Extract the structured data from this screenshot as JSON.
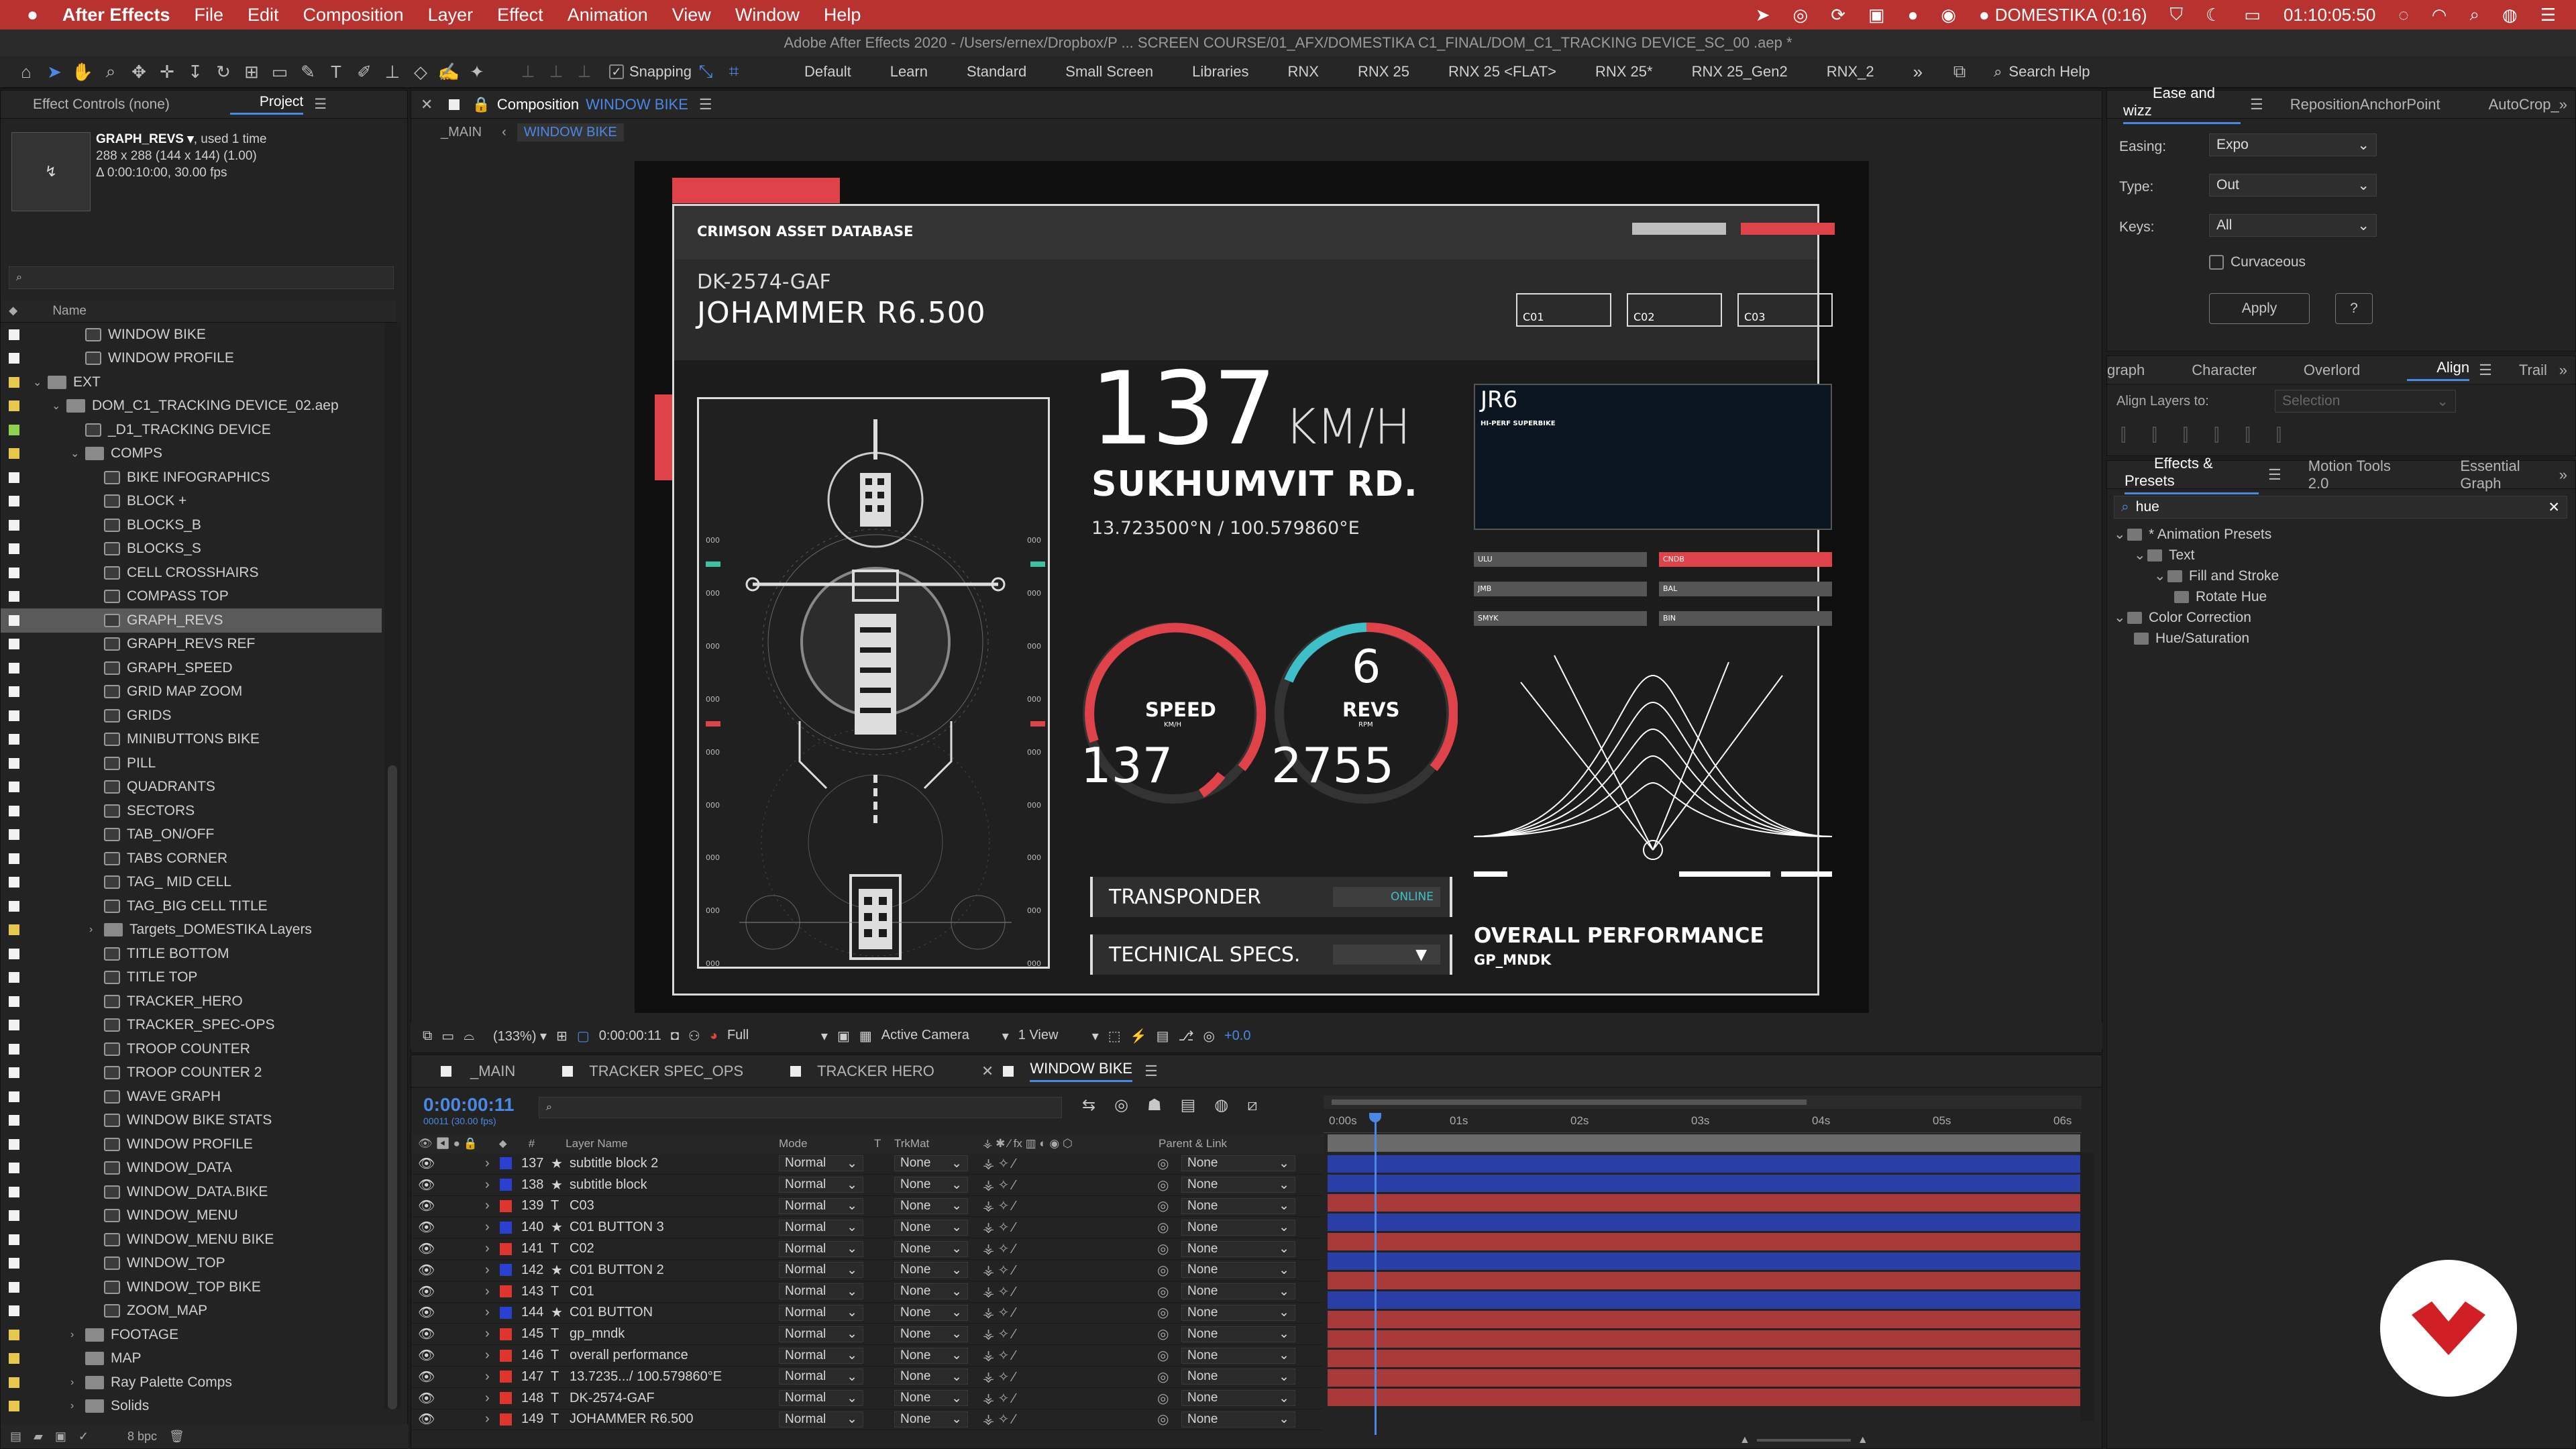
{
  "menubar": {
    "app": "After Effects",
    "items": [
      "File",
      "Edit",
      "Composition",
      "Layer",
      "Effect",
      "Animation",
      "View",
      "Window",
      "Help"
    ],
    "domestika": "DOMESTIKA (0:16)",
    "clock": "01:10:05:50"
  },
  "title": "Adobe After Effects 2020 - /Users/ernex/Dropbox/P ... SCREEN COURSE/01_AFX/DOMESTIKA C1_FINAL/DOM_C1_TRACKING DEVICE_SC_00 .aep *",
  "toolbar": {
    "snapping": "Snapping",
    "workspaces": [
      "Default",
      "Learn",
      "Standard",
      "Small Screen",
      "Libraries",
      "RNX",
      "RNX 25",
      "RNX 25 <FLAT>",
      "RNX 25*",
      "RNX 25_Gen2",
      "RNX_2"
    ],
    "search_help": "Search Help"
  },
  "project": {
    "tabs": [
      "Effect Controls (none)",
      "Project"
    ],
    "item_name": "GRAPH_REVS ▾",
    "item_used": ", used 1 time",
    "item_dims": "288 x 288  (144 x 144) (1.00)",
    "item_dur": "Δ 0:00:10:00, 30.00 fps",
    "col_name": "Name",
    "bpc": "8 bpc",
    "tree": [
      {
        "label": "WINDOW BIKE",
        "type": "comp",
        "indent": 2,
        "color": "#f2f2f2"
      },
      {
        "label": "WINDOW PROFILE",
        "type": "comp",
        "indent": 2,
        "color": "#f2f2f2"
      },
      {
        "label": "EXT",
        "type": "folder",
        "indent": 0,
        "color": "#e8c84a",
        "open": "v"
      },
      {
        "label": "DOM_C1_TRACKING DEVICE_02.aep",
        "type": "folder",
        "indent": 1,
        "color": "#e8c84a",
        "open": "v"
      },
      {
        "label": "_D1_TRACKING DEVICE",
        "type": "comp",
        "indent": 2,
        "color": "#8fd14f"
      },
      {
        "label": "COMPS",
        "type": "folder",
        "indent": 2,
        "color": "#e8c84a",
        "open": "v"
      },
      {
        "label": "BIKE INFOGRAPHICS",
        "type": "comp",
        "indent": 3,
        "color": "#f2f2f2"
      },
      {
        "label": "BLOCK +",
        "type": "comp",
        "indent": 3,
        "color": "#f2f2f2"
      },
      {
        "label": "BLOCKS_B",
        "type": "comp",
        "indent": 3,
        "color": "#f2f2f2"
      },
      {
        "label": "BLOCKS_S",
        "type": "comp",
        "indent": 3,
        "color": "#f2f2f2"
      },
      {
        "label": "CELL CROSSHAIRS",
        "type": "comp",
        "indent": 3,
        "color": "#f2f2f2"
      },
      {
        "label": "COMPASS TOP",
        "type": "comp",
        "indent": 3,
        "color": "#f2f2f2"
      },
      {
        "label": "GRAPH_REVS",
        "type": "comp",
        "indent": 3,
        "color": "#f2f2f2",
        "selected": true
      },
      {
        "label": "GRAPH_REVS REF",
        "type": "comp",
        "indent": 3,
        "color": "#f2f2f2"
      },
      {
        "label": "GRAPH_SPEED",
        "type": "comp",
        "indent": 3,
        "color": "#f2f2f2"
      },
      {
        "label": "GRID MAP ZOOM",
        "type": "comp",
        "indent": 3,
        "color": "#f2f2f2"
      },
      {
        "label": "GRIDS",
        "type": "comp",
        "indent": 3,
        "color": "#f2f2f2"
      },
      {
        "label": "MINIBUTTONS BIKE",
        "type": "comp",
        "indent": 3,
        "color": "#f2f2f2"
      },
      {
        "label": "PILL",
        "type": "comp",
        "indent": 3,
        "color": "#f2f2f2"
      },
      {
        "label": "QUADRANTS",
        "type": "comp",
        "indent": 3,
        "color": "#f2f2f2"
      },
      {
        "label": "SECTORS",
        "type": "comp",
        "indent": 3,
        "color": "#f2f2f2"
      },
      {
        "label": "TAB_ON/OFF",
        "type": "comp",
        "indent": 3,
        "color": "#f2f2f2"
      },
      {
        "label": "TABS CORNER",
        "type": "comp",
        "indent": 3,
        "color": "#f2f2f2"
      },
      {
        "label": "TAG_ MID CELL",
        "type": "comp",
        "indent": 3,
        "color": "#f2f2f2"
      },
      {
        "label": "TAG_BIG CELL TITLE",
        "type": "comp",
        "indent": 3,
        "color": "#f2f2f2"
      },
      {
        "label": "Targets_DOMESTIKA Layers",
        "type": "folder",
        "indent": 3,
        "color": "#e8c84a",
        "open": ">"
      },
      {
        "label": "TITLE BOTTOM",
        "type": "comp",
        "indent": 3,
        "color": "#f2f2f2"
      },
      {
        "label": "TITLE TOP",
        "type": "comp",
        "indent": 3,
        "color": "#f2f2f2"
      },
      {
        "label": "TRACKER_HERO",
        "type": "comp",
        "indent": 3,
        "color": "#f2f2f2"
      },
      {
        "label": "TRACKER_SPEC-OPS",
        "type": "comp",
        "indent": 3,
        "color": "#f2f2f2"
      },
      {
        "label": "TROOP COUNTER",
        "type": "comp",
        "indent": 3,
        "color": "#f2f2f2"
      },
      {
        "label": "TROOP COUNTER 2",
        "type": "comp",
        "indent": 3,
        "color": "#f2f2f2"
      },
      {
        "label": "WAVE GRAPH",
        "type": "comp",
        "indent": 3,
        "color": "#f2f2f2"
      },
      {
        "label": "WINDOW BIKE STATS",
        "type": "comp",
        "indent": 3,
        "color": "#f2f2f2"
      },
      {
        "label": "WINDOW PROFILE",
        "type": "comp",
        "indent": 3,
        "color": "#f2f2f2"
      },
      {
        "label": "WINDOW_DATA",
        "type": "comp",
        "indent": 3,
        "color": "#f2f2f2"
      },
      {
        "label": "WINDOW_DATA.BIKE",
        "type": "comp",
        "indent": 3,
        "color": "#f2f2f2"
      },
      {
        "label": "WINDOW_MENU",
        "type": "comp",
        "indent": 3,
        "color": "#f2f2f2"
      },
      {
        "label": "WINDOW_MENU BIKE",
        "type": "comp",
        "indent": 3,
        "color": "#f2f2f2"
      },
      {
        "label": "WINDOW_TOP",
        "type": "comp",
        "indent": 3,
        "color": "#f2f2f2"
      },
      {
        "label": "WINDOW_TOP BIKE",
        "type": "comp",
        "indent": 3,
        "color": "#f2f2f2"
      },
      {
        "label": "ZOOM_MAP",
        "type": "comp",
        "indent": 3,
        "color": "#f2f2f2"
      },
      {
        "label": "FOOTAGE",
        "type": "folder",
        "indent": 2,
        "color": "#e8c84a",
        "open": ">"
      },
      {
        "label": "MAP",
        "type": "folder",
        "indent": 2,
        "color": "#e8c84a"
      },
      {
        "label": "Ray Palette Comps",
        "type": "folder",
        "indent": 2,
        "color": "#e8c84a",
        "open": ">"
      },
      {
        "label": "Solids",
        "type": "folder",
        "indent": 2,
        "color": "#e8c84a",
        "open": ">"
      }
    ]
  },
  "composition": {
    "tab_prefix": "Composition",
    "tab_name": "WINDOW BIKE",
    "crumbs": [
      "_MAIN",
      "WINDOW BIKE"
    ],
    "zoom": "(133%)",
    "timecode": "0:00:00:11",
    "resolution": "Full",
    "camera": "Active Camera",
    "views": "1 View",
    "exposure": "+0.0"
  },
  "hud": {
    "header": "CRIMSON ASSET DATABASE",
    "code": "DK-2574-GAF",
    "model": "JOHAMMER R6.500",
    "btn1": "C01",
    "btn2": "C02",
    "btn3": "C03",
    "speed_value": "137",
    "speed_unit": "KM/H",
    "road": "SUKHUMVIT RD.",
    "coords": "13.723500°N / 100.579860°E",
    "gauge_speed_label": "SPEED",
    "gauge_speed_unit": "KM/H",
    "gauge_speed_value": "137",
    "gauge_revs_gear": "6",
    "gauge_revs_label": "REVS",
    "gauge_revs_unit": "RPM",
    "gauge_revs_value": "2755",
    "transponder": "TRANSPONDER",
    "online": "ONLINE",
    "tech": "TECHNICAL SPECS.",
    "jr_title": "JR6",
    "jr_sub": "HI-PERF SUPERBIKE",
    "tags": [
      "ULU",
      "CNDB",
      "JMB",
      "BAL",
      "SMYK",
      "BIN"
    ],
    "perf_title": "OVERALL PERFORMANCE",
    "perf_sub": "GP_MNDK",
    "side_nums": [
      "000",
      "000",
      "000",
      "000",
      "000",
      "000",
      "000",
      "000",
      "000",
      "000",
      "000",
      "000",
      "000",
      "000",
      "000",
      "000",
      "000",
      "000"
    ]
  },
  "timeline": {
    "tabs": [
      "_MAIN",
      "TRACKER SPEC_OPS",
      "TRACKER HERO",
      "WINDOW BIKE"
    ],
    "timecode": "0:00:00:11",
    "timecode_sub": "00011 (30.00 fps)",
    "cols": {
      "num": "#",
      "name": "Layer Name",
      "mode": "Mode",
      "t": "T",
      "trk": "TrkMat",
      "parent": "Parent & Link"
    },
    "ruler": [
      "0:00s",
      "01s",
      "02s",
      "03s",
      "04s",
      "05s",
      "06s"
    ],
    "rows": [
      {
        "num": "137",
        "type": "★",
        "name": "subtitle block 2",
        "mode": "Normal",
        "trk": "None",
        "parent": "None",
        "color": "#2b3fd0"
      },
      {
        "num": "138",
        "type": "★",
        "name": "subtitle block",
        "mode": "Normal",
        "trk": "None",
        "parent": "None",
        "color": "#2b3fd0"
      },
      {
        "num": "139",
        "type": "T",
        "name": "C03",
        "mode": "Normal",
        "trk": "None",
        "parent": "None",
        "color": "#e0342f"
      },
      {
        "num": "140",
        "type": "★",
        "name": "C01 BUTTON 3",
        "mode": "Normal",
        "trk": "None",
        "parent": "None",
        "color": "#2b3fd0"
      },
      {
        "num": "141",
        "type": "T",
        "name": "C02",
        "mode": "Normal",
        "trk": "None",
        "parent": "None",
        "color": "#e0342f"
      },
      {
        "num": "142",
        "type": "★",
        "name": "C01 BUTTON 2",
        "mode": "Normal",
        "trk": "None",
        "parent": "None",
        "color": "#2b3fd0"
      },
      {
        "num": "143",
        "type": "T",
        "name": "C01",
        "mode": "Normal",
        "trk": "None",
        "parent": "None",
        "color": "#e0342f"
      },
      {
        "num": "144",
        "type": "★",
        "name": "C01 BUTTON",
        "mode": "Normal",
        "trk": "None",
        "parent": "None",
        "color": "#2b3fd0"
      },
      {
        "num": "145",
        "type": "T",
        "name": "gp_mndk",
        "mode": "Normal",
        "trk": "None",
        "parent": "None",
        "color": "#e0342f"
      },
      {
        "num": "146",
        "type": "T",
        "name": "overall performance",
        "mode": "Normal",
        "trk": "None",
        "parent": "None",
        "color": "#e0342f"
      },
      {
        "num": "147",
        "type": "T",
        "name": "13.7235.../ 100.579860°E",
        "mode": "Normal",
        "trk": "None",
        "parent": "None",
        "color": "#e0342f"
      },
      {
        "num": "148",
        "type": "T",
        "name": "DK-2574-GAF",
        "mode": "Normal",
        "trk": "None",
        "parent": "None",
        "color": "#e0342f"
      },
      {
        "num": "149",
        "type": "T",
        "name": "JOHAMMER R6.500",
        "mode": "Normal",
        "trk": "None",
        "parent": "None",
        "color": "#e0342f"
      }
    ]
  },
  "ease": {
    "tabs": [
      "Ease and wizz",
      "RepositionAnchorPoint",
      "AutoCrop_"
    ],
    "easing_label": "Easing:",
    "easing_value": "Expo",
    "type_label": "Type:",
    "type_value": "Out",
    "keys_label": "Keys:",
    "keys_value": "All",
    "curvaceous": "Curvaceous",
    "apply": "Apply",
    "help": "?"
  },
  "align": {
    "tabs": [
      "graph",
      "Character",
      "Overlord",
      "Align",
      "Trail"
    ],
    "align_to": "Align Layers to:",
    "selection": "Selection"
  },
  "effects": {
    "tabs": [
      "Effects & Presets",
      "Motion Tools 2.0",
      "Essential Graph"
    ],
    "search": "hue",
    "tree": [
      {
        "label": "* Animation Presets",
        "indent": 0
      },
      {
        "label": "Text",
        "indent": 1
      },
      {
        "label": "Fill and Stroke",
        "indent": 2
      },
      {
        "label": "Rotate Hue",
        "indent": 3
      },
      {
        "label": "Color Correction",
        "indent": 0
      },
      {
        "label": "Hue/Saturation",
        "indent": 1
      }
    ]
  },
  "colors": {
    "menubar": "#b8332f",
    "accent": "#e0424a",
    "blue": "#4b88e6",
    "teal": "#3fc0c8",
    "label_red": "#e0342f",
    "label_blue": "#2b3fd0"
  }
}
